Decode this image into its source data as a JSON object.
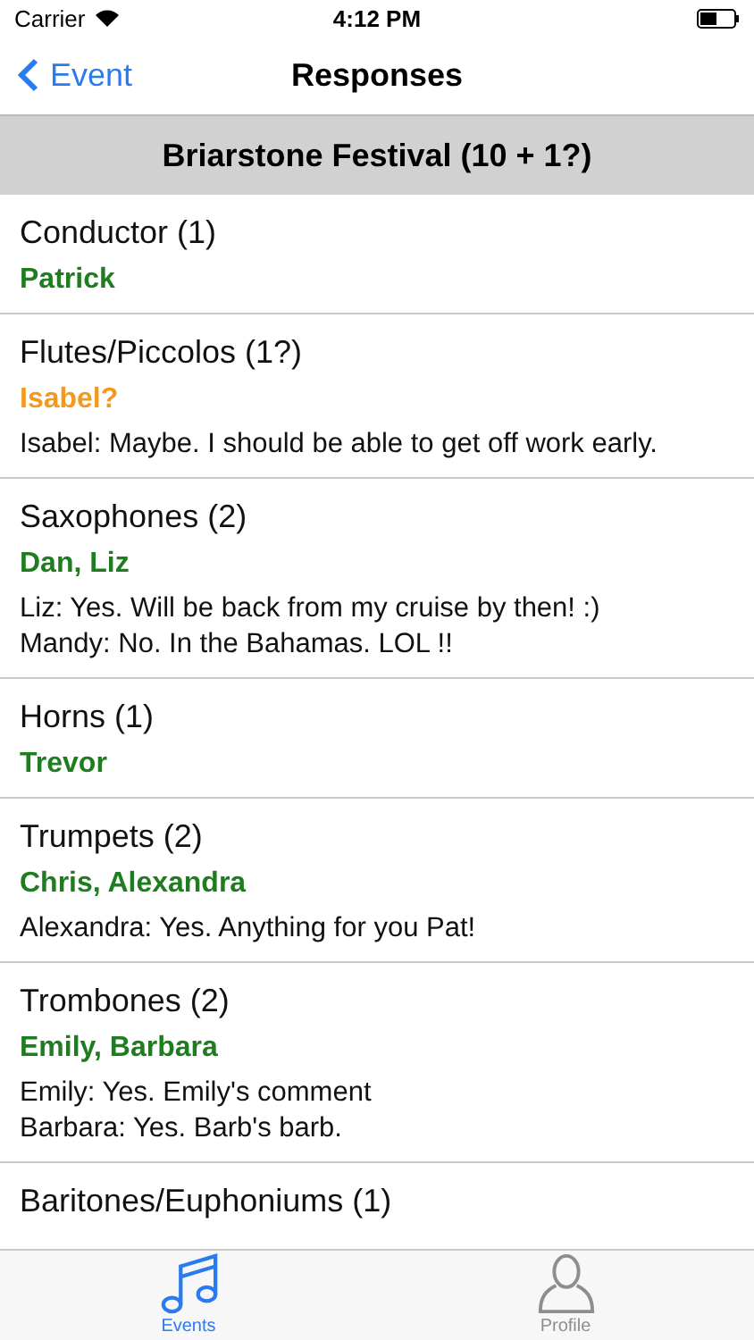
{
  "status_bar": {
    "carrier": "Carrier",
    "time": "4:12 PM"
  },
  "nav": {
    "back": "Event",
    "title": "Responses"
  },
  "header": "Briarstone Festival (10 + 1?)",
  "sections": [
    {
      "title": "Conductor (1)",
      "names": "Patrick",
      "color": "#1e7d1e"
    },
    {
      "title": "Flutes/Piccolos (1?)",
      "names": "Isabel?",
      "color": "#f39a1e",
      "comments": [
        "Isabel: Maybe. I should be able to get off work early."
      ]
    },
    {
      "title": "Saxophones (2)",
      "names": "Dan, Liz",
      "color": "#1e7d1e",
      "comments": [
        "Liz: Yes. Will be back from my cruise by then! :)",
        "Mandy: No. In the Bahamas. LOL !!"
      ]
    },
    {
      "title": "Horns (1)",
      "names": "Trevor",
      "color": "#1e7d1e"
    },
    {
      "title": "Trumpets (2)",
      "names": "Chris, Alexandra",
      "color": "#1e7d1e",
      "comments": [
        "Alexandra: Yes. Anything for you Pat!"
      ]
    },
    {
      "title": "Trombones (2)",
      "names": "Emily, Barbara",
      "color": "#1e7d1e",
      "comments": [
        "Emily: Yes. Emily's comment",
        "Barbara: Yes. Barb's barb."
      ]
    },
    {
      "title": "Baritones/Euphoniums (1)"
    }
  ],
  "tabs": [
    {
      "kind": "music",
      "label": "Events",
      "selected": true
    },
    {
      "kind": "person",
      "label": "Profile",
      "selected": false
    }
  ]
}
